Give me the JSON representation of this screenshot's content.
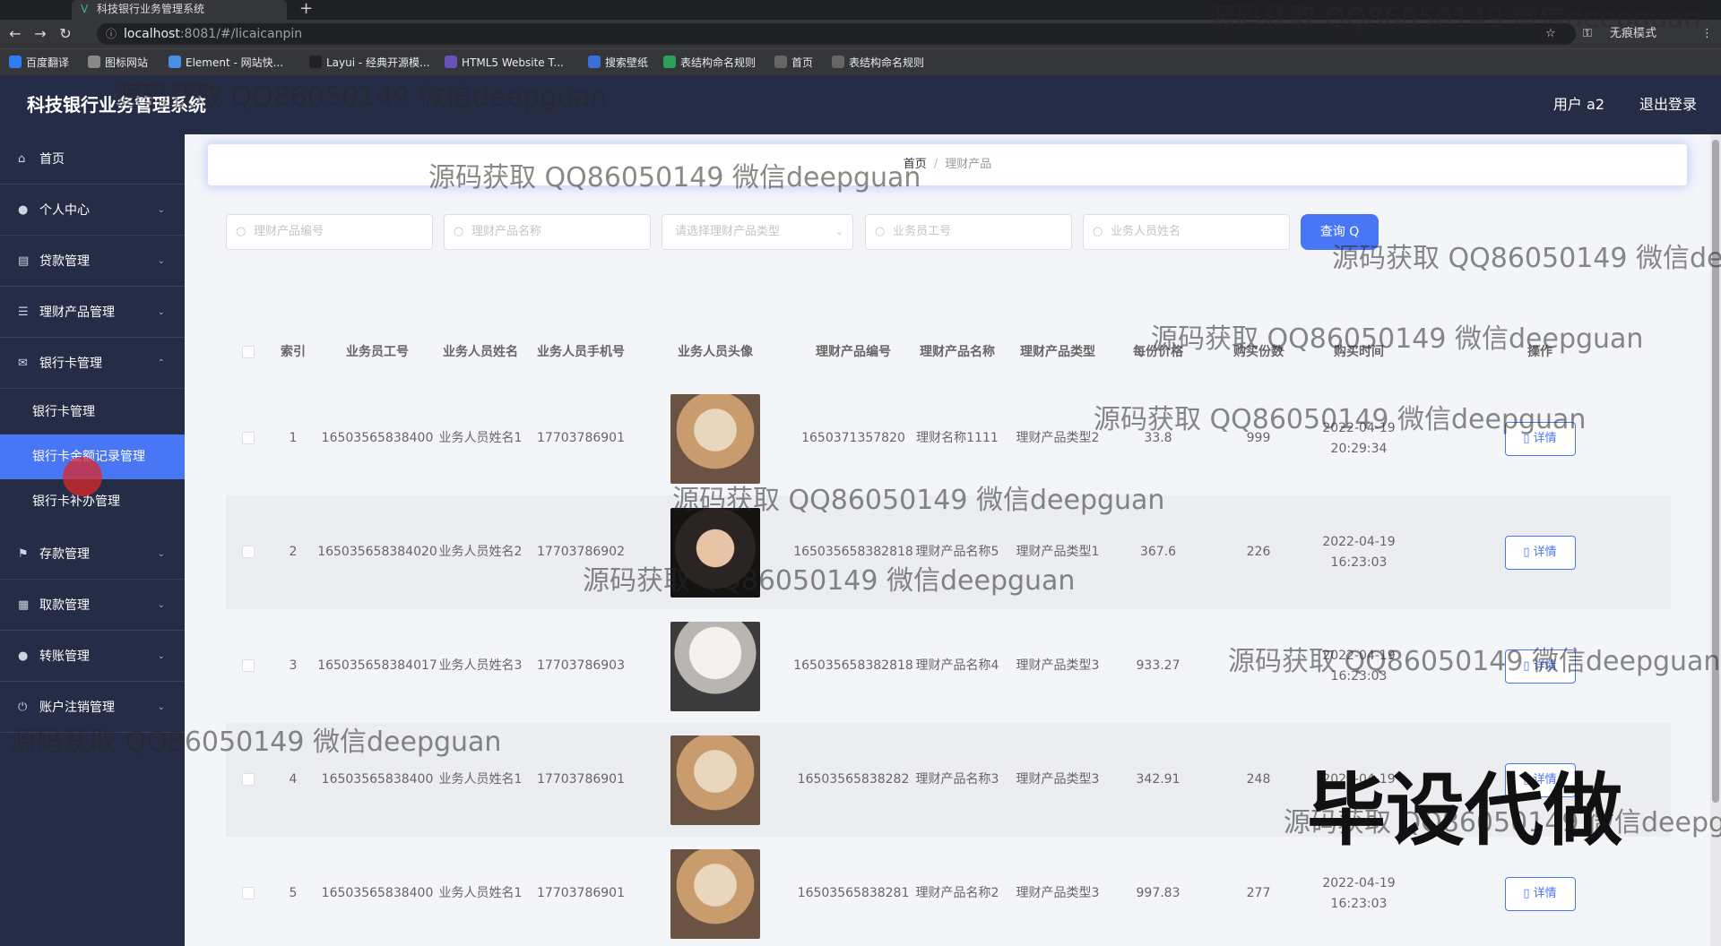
{
  "browser": {
    "tab_title": "科技银行业务管理系统",
    "url_host": "localhost",
    "url_path": ":8081/#/licaicanpin",
    "incognito_label": "无痕模式",
    "bookmarks": [
      "百度翻译",
      "图标网站",
      "Element - 网站快...",
      "Layui - 经典开源模...",
      "HTML5 Website T...",
      "搜索壁纸",
      "表结构命名规则",
      "首页",
      "表结构命名规则"
    ],
    "bookmark_colors": [
      "#2f7cf6",
      "#888888",
      "#4a90e2",
      "#222222",
      "#6b4fbb",
      "#3a6fd8",
      "#2aa05a",
      "#666666",
      "#666666"
    ]
  },
  "header": {
    "title": "科技银行业务管理系统",
    "user": "用户 a2",
    "logout": "退出登录"
  },
  "sidebar": {
    "items": [
      {
        "label": "首页",
        "icon": "home-icon",
        "glyph": "⌂",
        "expanded": false
      },
      {
        "label": "个人中心",
        "icon": "user-icon",
        "glyph": "●",
        "expanded": false
      },
      {
        "label": "贷款管理",
        "icon": "document-icon",
        "glyph": "▤",
        "expanded": false
      },
      {
        "label": "理财产品管理",
        "icon": "sliders-icon",
        "glyph": "☰",
        "expanded": false
      },
      {
        "label": "银行卡管理",
        "icon": "mail-icon",
        "glyph": "✉",
        "expanded": true
      },
      {
        "label": "存款管理",
        "icon": "flag-icon",
        "glyph": "⚑",
        "expanded": false
      },
      {
        "label": "取款管理",
        "icon": "calendar-icon",
        "glyph": "▦",
        "expanded": false
      },
      {
        "label": "转账管理",
        "icon": "user-icon",
        "glyph": "●",
        "expanded": false
      },
      {
        "label": "账户注销管理",
        "icon": "power-icon",
        "glyph": "⏻",
        "expanded": false
      }
    ],
    "sub_items": [
      {
        "label": "银行卡管理",
        "active": false
      },
      {
        "label": "银行卡金额记录管理",
        "active": true
      },
      {
        "label": "银行卡补办管理",
        "active": false
      }
    ]
  },
  "breadcrumb": {
    "home": "首页",
    "separator": "/",
    "current": "理财产品"
  },
  "search": {
    "product_no_placeholder": "理财产品编号",
    "product_name_placeholder": "理财产品名称",
    "product_type_placeholder": "请选择理财产品类型",
    "staff_no_placeholder": "业务员工号",
    "staff_name_placeholder": "业务人员姓名",
    "query_label": "查询 Q"
  },
  "table": {
    "headers": [
      "索引",
      "业务员工号",
      "业务人员姓名",
      "业务人员手机号",
      "业务人员头像",
      "理财产品编号",
      "理财产品名称",
      "理财产品类型",
      "每份价格",
      "购买份数",
      "购买时间",
      "操作"
    ],
    "detail_label": "详情",
    "rows": [
      {
        "index": "1",
        "staff_no": "16503565838400",
        "staff_name": "业务人员姓名1",
        "phone": "17703786901",
        "avatar": "cat-hat",
        "product_no": "1650371357820",
        "product_name": "理财名称1111",
        "product_type": "理财产品类型2",
        "price": "33.8",
        "count": "999",
        "time": "2022-04-19 20:29:34"
      },
      {
        "index": "2",
        "staff_no": "165035658384020",
        "staff_name": "业务人员姓名2",
        "phone": "17703786902",
        "avatar": "man",
        "product_no": "165035658382818",
        "product_name": "理财产品名称5",
        "product_type": "理财产品类型1",
        "price": "367.6",
        "count": "226",
        "time": "2022-04-19 16:23:03"
      },
      {
        "index": "3",
        "staff_no": "165035658384017",
        "staff_name": "业务人员姓名3",
        "phone": "17703786903",
        "avatar": "cat-white",
        "product_no": "165035658382818",
        "product_name": "理财产品名称4",
        "product_type": "理财产品类型3",
        "price": "933.27",
        "count": "",
        "time": "2022-04-19 16:23:03"
      },
      {
        "index": "4",
        "staff_no": "16503565838400",
        "staff_name": "业务人员姓名1",
        "phone": "17703786901",
        "avatar": "cat-hat",
        "product_no": "16503565838282",
        "product_name": "理财产品名称3",
        "product_type": "理财产品类型3",
        "price": "342.91",
        "count": "248",
        "time": "2022-04-19"
      },
      {
        "index": "5",
        "staff_no": "16503565838400",
        "staff_name": "业务人员姓名1",
        "phone": "17703786901",
        "avatar": "cat-hat",
        "product_no": "16503565838281",
        "product_name": "理财产品名称2",
        "product_type": "理财产品类型3",
        "price": "997.83",
        "count": "277",
        "time": "2022-04-19 16:23:03"
      }
    ]
  },
  "watermarks": {
    "text": "源码获取 QQ86050149 微信deepguan",
    "stamp": "毕设代做"
  },
  "colors": {
    "primary": "#4876f5",
    "sidebar_bg": "#252c46"
  }
}
